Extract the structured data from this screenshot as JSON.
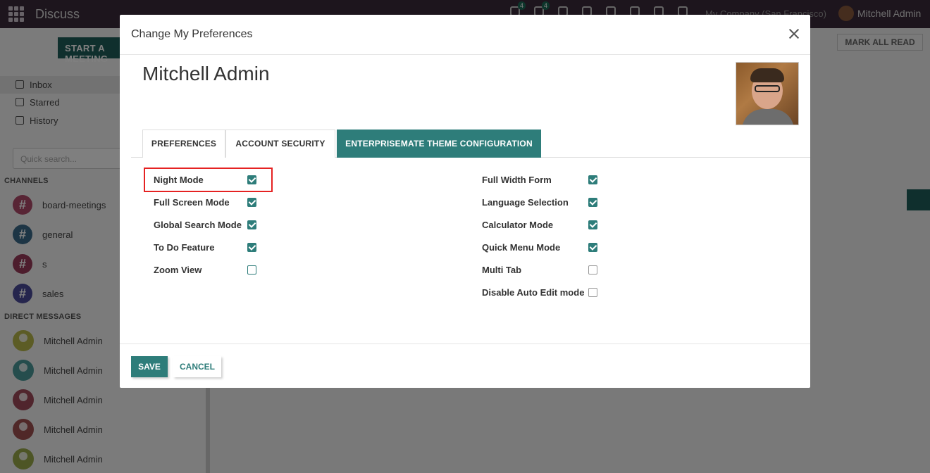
{
  "app": {
    "title": "Discuss",
    "company": "My Company (San Francisco)",
    "user": "Mitchell Admin",
    "badges": {
      "chat": "4",
      "activity": "4"
    }
  },
  "sidebar": {
    "start_meeting": "START A MEETING",
    "nav": [
      "Inbox",
      "Starred",
      "History"
    ],
    "search_placeholder": "Quick search...",
    "channels_header": "CHANNELS",
    "channels": [
      {
        "name": "board-meetings",
        "color": "#b04a6a"
      },
      {
        "name": "general",
        "color": "#3a6b8a"
      },
      {
        "name": "s",
        "color": "#9a3a5a"
      },
      {
        "name": "sales",
        "color": "#4a4a9a"
      }
    ],
    "dm_header": "DIRECT MESSAGES",
    "dms": [
      {
        "name": "Mitchell Admin",
        "color": "#b8b84a"
      },
      {
        "name": "Mitchell Admin",
        "color": "#4a9a9a"
      },
      {
        "name": "Mitchell Admin",
        "color": "#a04a5a"
      },
      {
        "name": "Mitchell Admin",
        "color": "#a05050"
      },
      {
        "name": "Mitchell Admin",
        "color": "#9aaa4a"
      }
    ]
  },
  "mark_all_read": "MARK ALL READ",
  "modal": {
    "title": "Change My Preferences",
    "user_name": "Mitchell Admin",
    "tabs": [
      "PREFERENCES",
      "ACCOUNT SECURITY",
      "ENTERPRISEMATE THEME CONFIGURATION"
    ],
    "active_tab": "ENTERPRISEMATE THEME CONFIGURATION",
    "left_fields": [
      {
        "label": "Night Mode",
        "checked": true
      },
      {
        "label": "Full Screen Mode",
        "checked": true
      },
      {
        "label": "Global Search Mode",
        "checked": true
      },
      {
        "label": "To Do Feature",
        "checked": true
      },
      {
        "label": "Zoom View",
        "checked": false
      }
    ],
    "right_fields": [
      {
        "label": "Full Width Form",
        "checked": true
      },
      {
        "label": "Language Selection",
        "checked": true
      },
      {
        "label": "Calculator Mode",
        "checked": true
      },
      {
        "label": "Quick Menu Mode",
        "checked": true
      },
      {
        "label": "Multi Tab",
        "checked": false
      },
      {
        "label": "Disable Auto Edit mode",
        "checked": false
      }
    ],
    "save": "SAVE",
    "cancel": "CANCEL"
  },
  "colors": {
    "accent": "#2e7d7a",
    "topbar": "#3b2a3b",
    "highlight": "#e52222"
  }
}
